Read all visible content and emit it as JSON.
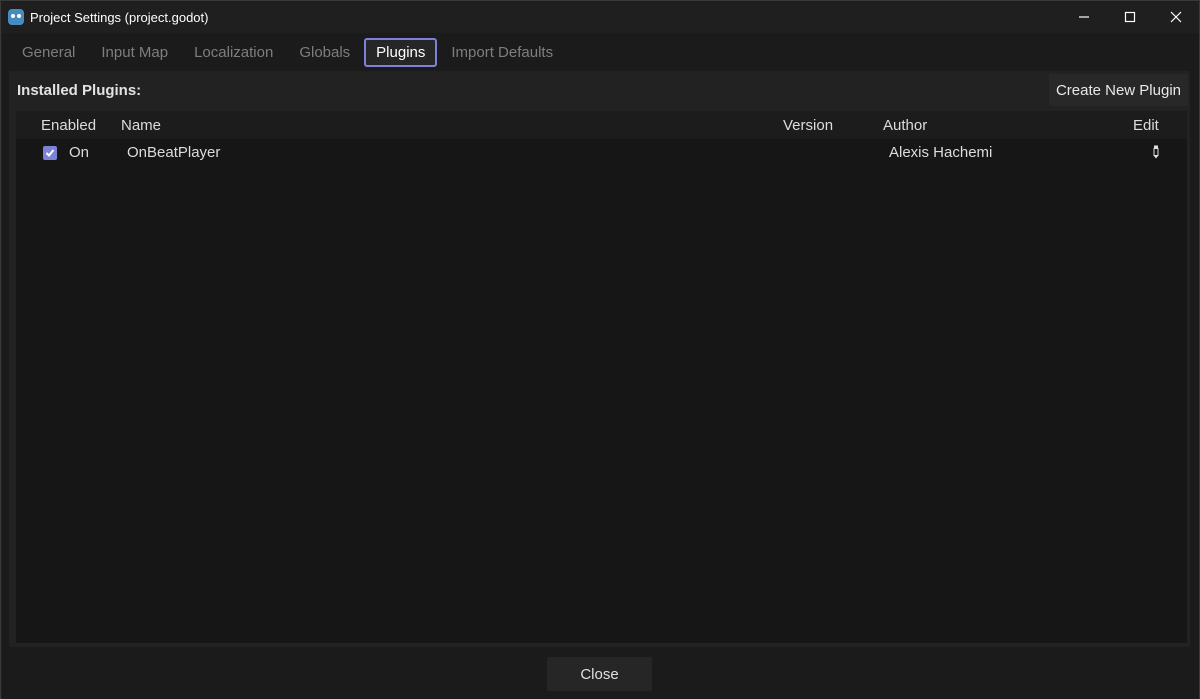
{
  "window": {
    "title": "Project Settings (project.godot)",
    "controls": {
      "minimize": "—",
      "maximize": "☐",
      "close": "✕"
    }
  },
  "tabs": [
    {
      "label": "General",
      "active": false
    },
    {
      "label": "Input Map",
      "active": false
    },
    {
      "label": "Localization",
      "active": false
    },
    {
      "label": "Globals",
      "active": false
    },
    {
      "label": "Plugins",
      "active": true
    },
    {
      "label": "Import Defaults",
      "active": false
    }
  ],
  "plugins": {
    "installed_label": "Installed Plugins:",
    "create_button": "Create New Plugin",
    "columns": {
      "enabled": "Enabled",
      "name": "Name",
      "version": "Version",
      "author": "Author",
      "edit": "Edit"
    },
    "rows": [
      {
        "checked": true,
        "status": "On",
        "name": "OnBeatPlayer",
        "version": "",
        "author": "Alexis Hachemi",
        "edit_icon": "pencil-icon"
      }
    ]
  },
  "footer": {
    "close_label": "Close"
  },
  "colors": {
    "accent": "#7c82d8",
    "background": "#1b1b1b",
    "panel": "#222222",
    "table": "#161616"
  }
}
